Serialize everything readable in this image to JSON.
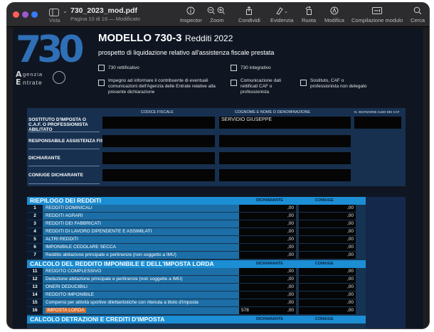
{
  "window": {
    "title": "730_2023_mod.pdf",
    "subtitle": "Pagina 10 di 16 — Modificato"
  },
  "toolbar": {
    "sidebar_label": "Vista",
    "tools": [
      {
        "label": "Inspector",
        "icon": "info-icon"
      },
      {
        "label": "Zoom",
        "icon": "zoom-icon"
      },
      {
        "label": "Condividi",
        "icon": "share-icon"
      },
      {
        "label": "Evidenzia",
        "icon": "highlighter-icon"
      },
      {
        "label": "Ruota",
        "icon": "rotate-icon"
      },
      {
        "label": "Modifica",
        "icon": "markup-icon"
      },
      {
        "label": "Compilazione modulo",
        "icon": "form-fill-icon"
      },
      {
        "label": "Cerca",
        "icon": "search-icon"
      }
    ]
  },
  "form": {
    "logo_number": "730",
    "logo_agenzia": "genzia",
    "logo_entrate": "ntrate",
    "title": "MODELLO 730-3",
    "title_sub": "Redditi 2022",
    "subtitle": "prospetto di liquidazione relativo all'assistenza fiscale prestata",
    "checkboxes": {
      "rettificativo": "730 rettificativo",
      "integrativo": "730 integrativo",
      "impegno": "Impegno ad informare il contribuente di eventuali comunicazioni dell'Agenzia delle Entrate relative alla presente dichiarazione",
      "comunicazione": "Comunicazione dati rettificati CAF o professionista",
      "sostituto": "Sostituto, CAF o professionista non delegato"
    },
    "header": {
      "col_codice_fiscale": "CODICE FISCALE",
      "col_cognome": "COGNOME E NOME O DENOMINAZIONE",
      "col_iscrizione": "N. ISCRIZIONE ALBO DEI CAF",
      "row_sostituto": "SOSTITUTO D'IMPOSTA O C.A.F. O PROFESSIONISTA ABILITATO",
      "row_responsabile": "RESPONSABILE ASSISTENZA FISCALE",
      "row_dichiarante": "DICHIARANTE",
      "row_coniuge": "CONIUGE DICHIARANTE",
      "sostituto_name": "SERVIDIO GIUSEPPE"
    },
    "summary": {
      "col_dichiarante": "DICHIARANTE",
      "col_coniuge": "CONIUGE",
      "sections": [
        {
          "title": "RIEPILOGO DEI REDDITI",
          "rows": [
            {
              "num": "1",
              "desc": "REDDITI DOMINICALI",
              "dich": ",00",
              "con": ",00"
            },
            {
              "num": "2",
              "desc": "REDDITI AGRARI",
              "dich": ",00",
              "con": ",00"
            },
            {
              "num": "3",
              "desc": "REDDITI DEI FABBRICATI",
              "dich": ",00",
              "con": ",00"
            },
            {
              "num": "4",
              "desc": "REDDITI DI LAVORO DIPENDENTE E ASSIMILATI",
              "dich": ",00",
              "con": ",00"
            },
            {
              "num": "5",
              "desc": "ALTRI REDDITI",
              "dich": ",00",
              "con": ",00"
            },
            {
              "num": "6",
              "desc": "IMPONIBILE CEDOLARE SECCA",
              "dich": ",00",
              "con": ",00"
            },
            {
              "num": "7",
              "desc": "Reddito abitazione principale e pertinenze (non soggetto a IMU)",
              "dich": ",00",
              "con": ",00"
            }
          ]
        },
        {
          "title": "CALCOLO DEL REDDITO IMPONIBILE E DELL'IMPOSTA LORDA",
          "rows": [
            {
              "num": "11",
              "desc": "REDDITO COMPLESSIVO",
              "dich": ",00",
              "con": ",00"
            },
            {
              "num": "12",
              "desc": "Deduzione abitazione principale e pertinenze (non soggette a IMU)",
              "dich": ",00",
              "con": ",00"
            },
            {
              "num": "13",
              "desc": "ONERI DEDUCIBILI",
              "dich": ",00",
              "con": ",00"
            },
            {
              "num": "14",
              "desc": "REDDITO IMPONIBILE",
              "dich": ",00",
              "con": ",00"
            },
            {
              "num": "15",
              "desc": "Compensi per attività sportive dilettantistiche con ritenuta a titolo d'imposta",
              "dich": ",00",
              "con": ",00"
            },
            {
              "num": "16",
              "desc": "IMPOSTA LORDA",
              "dich_left": "578",
              "dich": ",00",
              "con": ",00"
            }
          ]
        },
        {
          "title": "CALCOLO DETRAZIONI E CREDITI D'IMPOSTA",
          "rows": []
        }
      ]
    }
  }
}
